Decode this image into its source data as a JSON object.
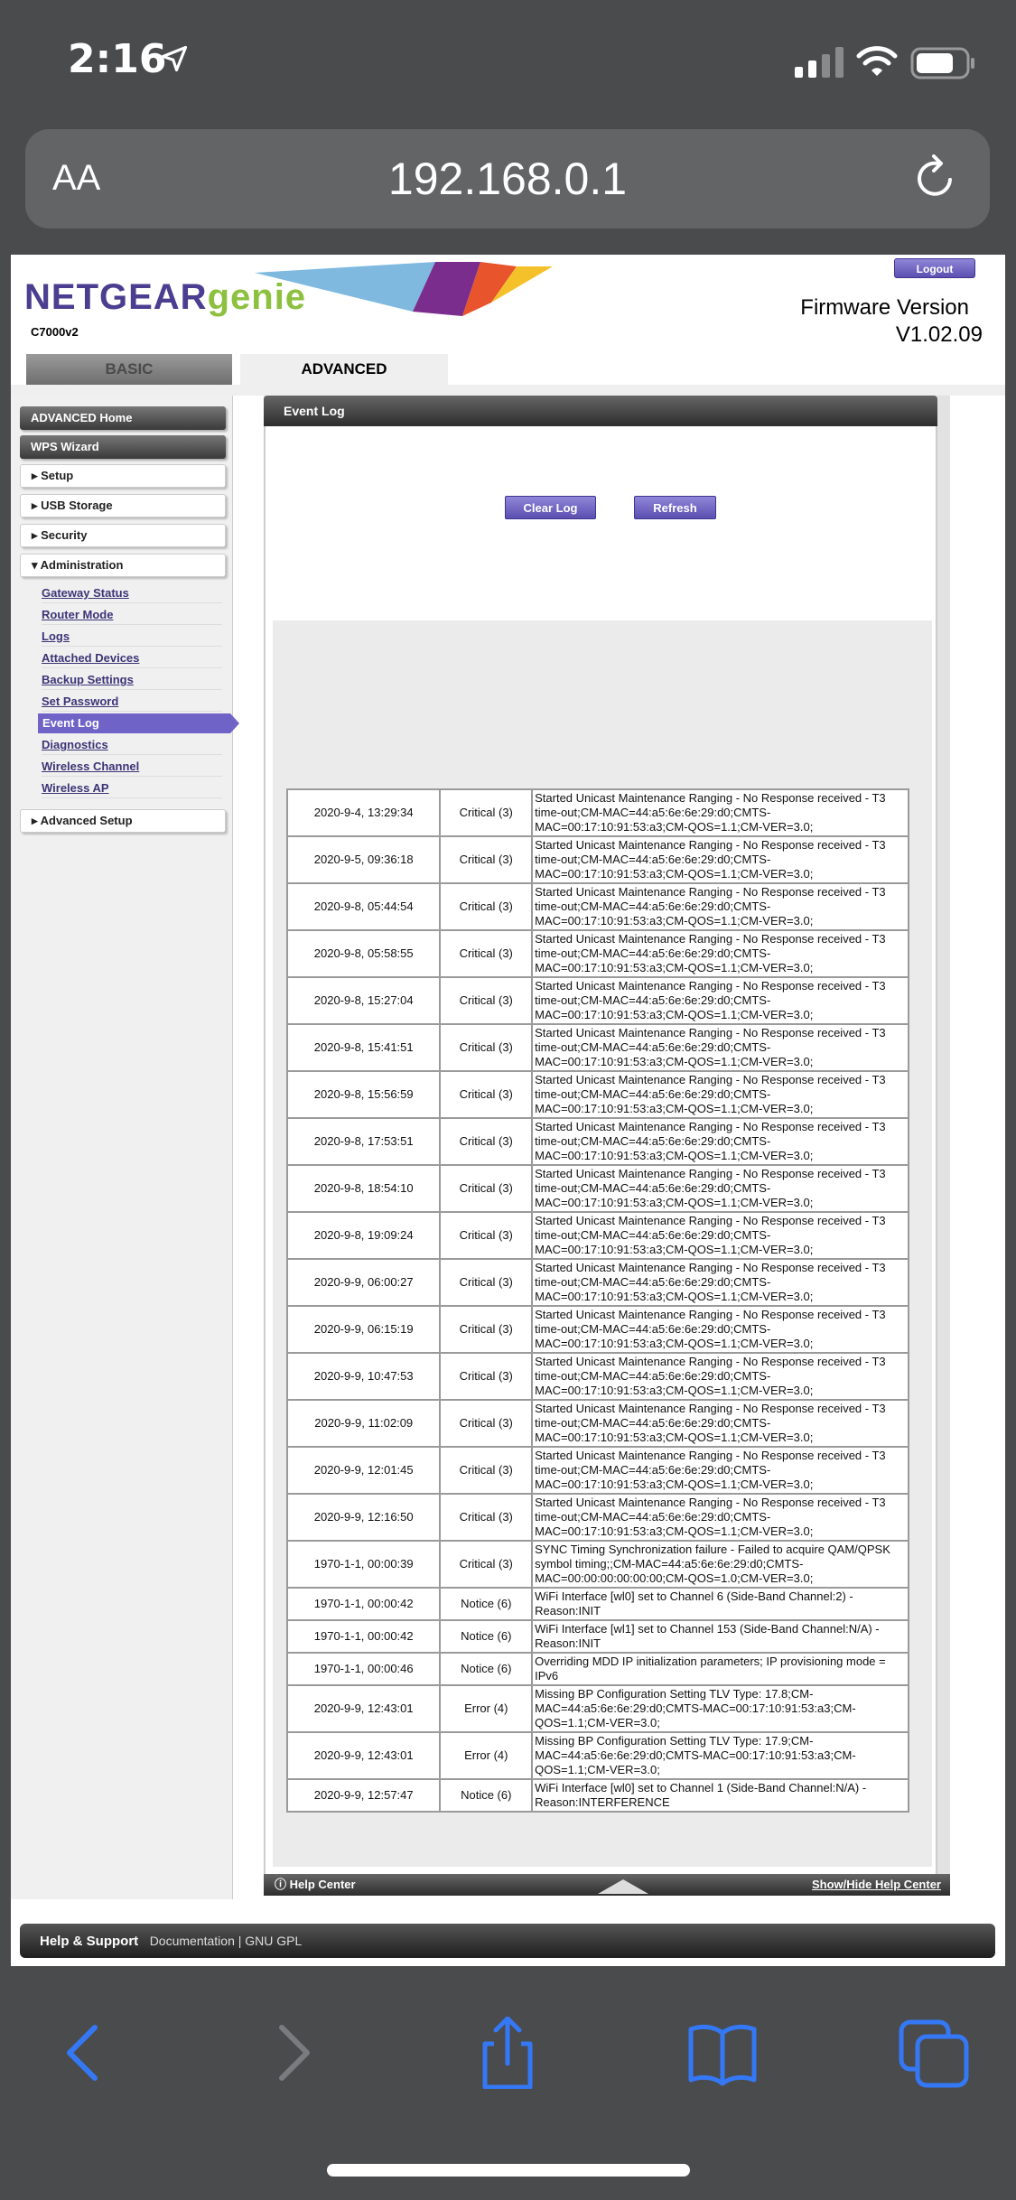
{
  "status_bar": {
    "time": "2:16"
  },
  "browser": {
    "aa_label": "AA",
    "url": "192.168.0.1"
  },
  "header": {
    "brand": "NETGEAR",
    "brand_suffix": "genie",
    "model": "C7000v2",
    "logout_label": "Logout",
    "firmware_label": "Firmware Version",
    "firmware_version": "V1.02.09"
  },
  "tabs": {
    "basic": "BASIC",
    "advanced": "ADVANCED"
  },
  "sidebar": {
    "advanced_home": "ADVANCED Home",
    "wps_wizard": "WPS Wizard",
    "setup": "Setup",
    "usb_storage": "USB Storage",
    "security": "Security",
    "administration": "Administration",
    "sub_items": [
      "Gateway Status",
      "Router Mode",
      "Logs",
      "Attached Devices",
      "Backup Settings",
      "Set Password",
      "Event Log",
      "Diagnostics",
      "Wireless Channel",
      "Wireless AP"
    ],
    "active_item": "Event Log",
    "advanced_setup": "Advanced Setup"
  },
  "panel": {
    "title": "Event Log",
    "clear_log": "Clear Log",
    "refresh": "Refresh"
  },
  "log_rows": [
    [
      "2020-9-4, 13:29:34",
      "Critical (3)",
      "Started Unicast Maintenance Ranging - No Response received - T3 time-out;CM-MAC=44:a5:6e:6e:29:d0;CMTS-MAC=00:17:10:91:53:a3;CM-QOS=1.1;CM-VER=3.0;"
    ],
    [
      "2020-9-5, 09:36:18",
      "Critical (3)",
      "Started Unicast Maintenance Ranging - No Response received - T3 time-out;CM-MAC=44:a5:6e:6e:29:d0;CMTS-MAC=00:17:10:91:53:a3;CM-QOS=1.1;CM-VER=3.0;"
    ],
    [
      "2020-9-8, 05:44:54",
      "Critical (3)",
      "Started Unicast Maintenance Ranging - No Response received - T3 time-out;CM-MAC=44:a5:6e:6e:29:d0;CMTS-MAC=00:17:10:91:53:a3;CM-QOS=1.1;CM-VER=3.0;"
    ],
    [
      "2020-9-8, 05:58:55",
      "Critical (3)",
      "Started Unicast Maintenance Ranging - No Response received - T3 time-out;CM-MAC=44:a5:6e:6e:29:d0;CMTS-MAC=00:17:10:91:53:a3;CM-QOS=1.1;CM-VER=3.0;"
    ],
    [
      "2020-9-8, 15:27:04",
      "Critical (3)",
      "Started Unicast Maintenance Ranging - No Response received - T3 time-out;CM-MAC=44:a5:6e:6e:29:d0;CMTS-MAC=00:17:10:91:53:a3;CM-QOS=1.1;CM-VER=3.0;"
    ],
    [
      "2020-9-8, 15:41:51",
      "Critical (3)",
      "Started Unicast Maintenance Ranging - No Response received - T3 time-out;CM-MAC=44:a5:6e:6e:29:d0;CMTS-MAC=00:17:10:91:53:a3;CM-QOS=1.1;CM-VER=3.0;"
    ],
    [
      "2020-9-8, 15:56:59",
      "Critical (3)",
      "Started Unicast Maintenance Ranging - No Response received - T3 time-out;CM-MAC=44:a5:6e:6e:29:d0;CMTS-MAC=00:17:10:91:53:a3;CM-QOS=1.1;CM-VER=3.0;"
    ],
    [
      "2020-9-8, 17:53:51",
      "Critical (3)",
      "Started Unicast Maintenance Ranging - No Response received - T3 time-out;CM-MAC=44:a5:6e:6e:29:d0;CMTS-MAC=00:17:10:91:53:a3;CM-QOS=1.1;CM-VER=3.0;"
    ],
    [
      "2020-9-8, 18:54:10",
      "Critical (3)",
      "Started Unicast Maintenance Ranging - No Response received - T3 time-out;CM-MAC=44:a5:6e:6e:29:d0;CMTS-MAC=00:17:10:91:53:a3;CM-QOS=1.1;CM-VER=3.0;"
    ],
    [
      "2020-9-8, 19:09:24",
      "Critical (3)",
      "Started Unicast Maintenance Ranging - No Response received - T3 time-out;CM-MAC=44:a5:6e:6e:29:d0;CMTS-MAC=00:17:10:91:53:a3;CM-QOS=1.1;CM-VER=3.0;"
    ],
    [
      "2020-9-9, 06:00:27",
      "Critical (3)",
      "Started Unicast Maintenance Ranging - No Response received - T3 time-out;CM-MAC=44:a5:6e:6e:29:d0;CMTS-MAC=00:17:10:91:53:a3;CM-QOS=1.1;CM-VER=3.0;"
    ],
    [
      "2020-9-9, 06:15:19",
      "Critical (3)",
      "Started Unicast Maintenance Ranging - No Response received - T3 time-out;CM-MAC=44:a5:6e:6e:29:d0;CMTS-MAC=00:17:10:91:53:a3;CM-QOS=1.1;CM-VER=3.0;"
    ],
    [
      "2020-9-9, 10:47:53",
      "Critical (3)",
      "Started Unicast Maintenance Ranging - No Response received - T3 time-out;CM-MAC=44:a5:6e:6e:29:d0;CMTS-MAC=00:17:10:91:53:a3;CM-QOS=1.1;CM-VER=3.0;"
    ],
    [
      "2020-9-9, 11:02:09",
      "Critical (3)",
      "Started Unicast Maintenance Ranging - No Response received - T3 time-out;CM-MAC=44:a5:6e:6e:29:d0;CMTS-MAC=00:17:10:91:53:a3;CM-QOS=1.1;CM-VER=3.0;"
    ],
    [
      "2020-9-9, 12:01:45",
      "Critical (3)",
      "Started Unicast Maintenance Ranging - No Response received - T3 time-out;CM-MAC=44:a5:6e:6e:29:d0;CMTS-MAC=00:17:10:91:53:a3;CM-QOS=1.1;CM-VER=3.0;"
    ],
    [
      "2020-9-9, 12:16:50",
      "Critical (3)",
      "Started Unicast Maintenance Ranging - No Response received - T3 time-out;CM-MAC=44:a5:6e:6e:29:d0;CMTS-MAC=00:17:10:91:53:a3;CM-QOS=1.1;CM-VER=3.0;"
    ],
    [
      "1970-1-1, 00:00:39",
      "Critical (3)",
      "SYNC Timing Synchronization failure - Failed to acquire QAM/QPSK symbol timing;;CM-MAC=44:a5:6e:6e:29:d0;CMTS-MAC=00:00:00:00:00:00;CM-QOS=1.0;CM-VER=3.0;"
    ],
    [
      "1970-1-1, 00:00:42",
      "Notice (6)",
      "WiFi Interface [wl0] set to Channel 6 (Side-Band Channel:2) - Reason:INIT"
    ],
    [
      "1970-1-1, 00:00:42",
      "Notice (6)",
      "WiFi Interface [wl1] set to Channel 153 (Side-Band Channel:N/A) - Reason:INIT"
    ],
    [
      "1970-1-1, 00:00:46",
      "Notice (6)",
      "Overriding MDD IP initialization parameters; IP provisioning mode = IPv6"
    ],
    [
      "2020-9-9, 12:43:01",
      "Error (4)",
      "Missing BP Configuration Setting TLV Type: 17.8;CM-MAC=44:a5:6e:6e:29:d0;CMTS-MAC=00:17:10:91:53:a3;CM-QOS=1.1;CM-VER=3.0;"
    ],
    [
      "2020-9-9, 12:43:01",
      "Error (4)",
      "Missing BP Configuration Setting TLV Type: 17.9;CM-MAC=44:a5:6e:6e:29:d0;CMTS-MAC=00:17:10:91:53:a3;CM-QOS=1.1;CM-VER=3.0;"
    ],
    [
      "2020-9-9, 12:57:47",
      "Notice (6)",
      "WiFi Interface [wl0] set to Channel 1 (Side-Band Channel:N/A) - Reason:INTERFERENCE"
    ]
  ],
  "help": {
    "left": "Help Center",
    "right": "Show/Hide Help Center"
  },
  "footer": {
    "title": "Help & Support",
    "links": "Documentation  | GNU GPL"
  },
  "toolbar": {
    "icons": [
      "back-icon",
      "forward-icon",
      "share-icon",
      "bookmarks-icon",
      "tabs-icon"
    ]
  },
  "colors": {
    "accent": "#6f63c8",
    "brand": "#4b3d8f",
    "genie": "#8dc03f",
    "ios_blue": "#3478f6"
  }
}
